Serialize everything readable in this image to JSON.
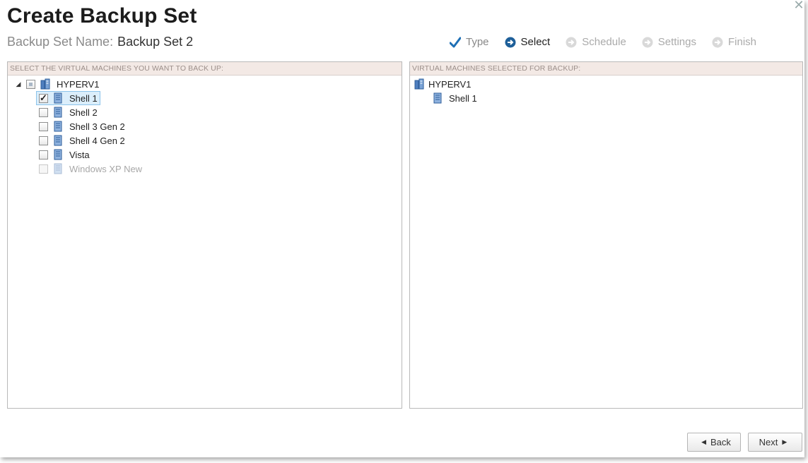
{
  "dialog": {
    "title": "Create Backup Set",
    "close_glyph": "✕",
    "set_name_label": "Backup Set Name:",
    "set_name_value": "Backup Set 2"
  },
  "steps": [
    {
      "label": "Type",
      "state": "done",
      "icon": "checkmark-icon"
    },
    {
      "label": "Select",
      "state": "active",
      "icon": "arrow-circle-icon"
    },
    {
      "label": "Schedule",
      "state": "pending",
      "icon": "arrow-circle-icon"
    },
    {
      "label": "Settings",
      "state": "pending",
      "icon": "arrow-circle-icon"
    },
    {
      "label": "Finish",
      "state": "pending",
      "icon": "arrow-circle-icon"
    }
  ],
  "left_panel": {
    "header": "SELECT THE VIRTUAL MACHINES YOU WANT TO BACK UP:",
    "host": {
      "name": "HYPERV1",
      "expander": "◢",
      "check": "partial"
    },
    "vms": [
      {
        "name": "Shell 1",
        "check": "checked",
        "selected": true,
        "disabled": false
      },
      {
        "name": "Shell 2",
        "check": "unchecked",
        "selected": false,
        "disabled": false
      },
      {
        "name": "Shell 3 Gen 2",
        "check": "unchecked",
        "selected": false,
        "disabled": false
      },
      {
        "name": "Shell 4 Gen 2",
        "check": "unchecked",
        "selected": false,
        "disabled": false
      },
      {
        "name": "Vista",
        "check": "unchecked",
        "selected": false,
        "disabled": false
      },
      {
        "name": "Windows XP New",
        "check": "unchecked",
        "selected": false,
        "disabled": true
      }
    ]
  },
  "right_panel": {
    "header": "VIRTUAL MACHINES SELECTED FOR BACKUP:",
    "host": "HYPERV1",
    "vms": [
      "Shell 1"
    ]
  },
  "buttons": {
    "back_label": "Back",
    "next_label": "Next"
  },
  "colors": {
    "accent": "#1e6fb5",
    "header_bg": "#f3e9e5",
    "selection_bg": "#dbeefb"
  }
}
